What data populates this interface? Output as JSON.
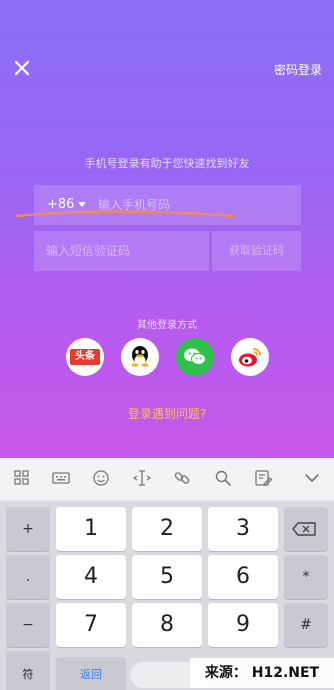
{
  "header": {
    "password_login": "密码登录"
  },
  "form": {
    "hint": "手机号登录有助于您快速找到好友",
    "country_code": "+86",
    "phone_placeholder": "输入手机号码",
    "code_placeholder": "输入短信验证码",
    "get_code": "获取验证码"
  },
  "other_login": {
    "label": "其他登录方式",
    "toutiao_text": "头条"
  },
  "help": {
    "trouble": "登录遇到问题?"
  },
  "keyboard": {
    "side_left": [
      "+",
      ".",
      "−",
      "("
    ],
    "digits": [
      "1",
      "2",
      "3",
      "4",
      "5",
      "6",
      "7",
      "8",
      "9"
    ],
    "side_right_star": "*",
    "side_right_hash": "#",
    "symbol_key": "符",
    "back_key": "返回"
  },
  "watermark": "来源： H12.NET",
  "colors": {
    "gradient_top": "#8a6ef5",
    "gradient_bottom": "#c558ea",
    "accent_orange": "#ffbe6b",
    "toutiao_red": "#e63b2e",
    "wechat_green": "#2fc24a"
  }
}
